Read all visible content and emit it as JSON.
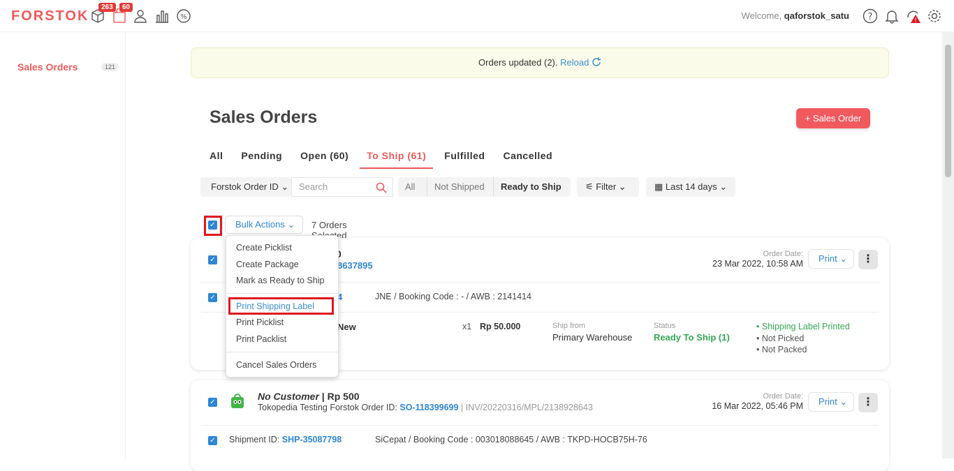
{
  "topbar": {
    "logo": "FORSTOK",
    "badges": [
      "263",
      "60"
    ],
    "welcome_prefix": "Welcome,",
    "username": "qaforstok_satu",
    "icons": [
      "box-icon",
      "bag-icon",
      "user-icon",
      "chart-icon",
      "discount-icon",
      "help-icon",
      "bell-icon",
      "alert-icon",
      "gear-icon"
    ]
  },
  "sidebar": {
    "items": [
      {
        "label": "Sales Orders",
        "count": "121"
      }
    ]
  },
  "notice": {
    "text": "Orders updated (2).",
    "link": "Reload"
  },
  "page": {
    "title": "Sales Orders",
    "add_button": "+ Sales Order"
  },
  "tabs": [
    "All",
    "Pending",
    "Open (60)",
    "To Ship (61)",
    "Fulfilled",
    "Cancelled"
  ],
  "filters": {
    "id_select": "Forstok Order ID",
    "search_placeholder": "Search",
    "segments": [
      "All",
      "Not Shipped",
      "Ready to Ship"
    ],
    "filter_label": "Filter",
    "date_label": "Last 14 days"
  },
  "bulk": {
    "button": "Bulk Actions",
    "selected_text": "7 Orders Selected"
  },
  "dropdown": {
    "group1": [
      "Create Picklist",
      "Create Package",
      "Mark as Ready to Ship"
    ],
    "group2": [
      "Print Shipping Label",
      "Print Picklist",
      "Print Packlist"
    ],
    "group3": [
      "Cancel Sales Orders"
    ]
  },
  "order1": {
    "title_tail": "0",
    "order_id_tail": "8637895",
    "date_label": "Order Date:",
    "date": "23 Mar 2022, 10:58 AM",
    "print": "Print",
    "shipment_tail": "4",
    "courier": "JNE / Booking Code : - / AWB : 2141414",
    "item_tail": "New",
    "qty": "x1",
    "price": "Rp 50.000",
    "ship_from_label": "Ship from",
    "ship_from": "Primary Warehouse",
    "status_label": "Status",
    "status": "Ready To Ship (1)",
    "flags": [
      "Shipping Label Printed",
      "Not Picked",
      "Not Packed"
    ]
  },
  "order2": {
    "customer": "No Customer",
    "amount": "Rp 500",
    "store_prefix": "Tokopedia Testing Forstok Order ID:",
    "order_id": "SO-118399699",
    "invoice": "INV/20220316/MPL/2138928643",
    "date_label": "Order Date:",
    "date": "16 Mar 2022, 05:46 PM",
    "print": "Print",
    "shipment_label": "Shipment ID:",
    "shipment_id": "SHP-35087798",
    "courier": "SiCepat / Booking Code : 003018088645 / AWB : TKPD-HOCB75H-76"
  }
}
